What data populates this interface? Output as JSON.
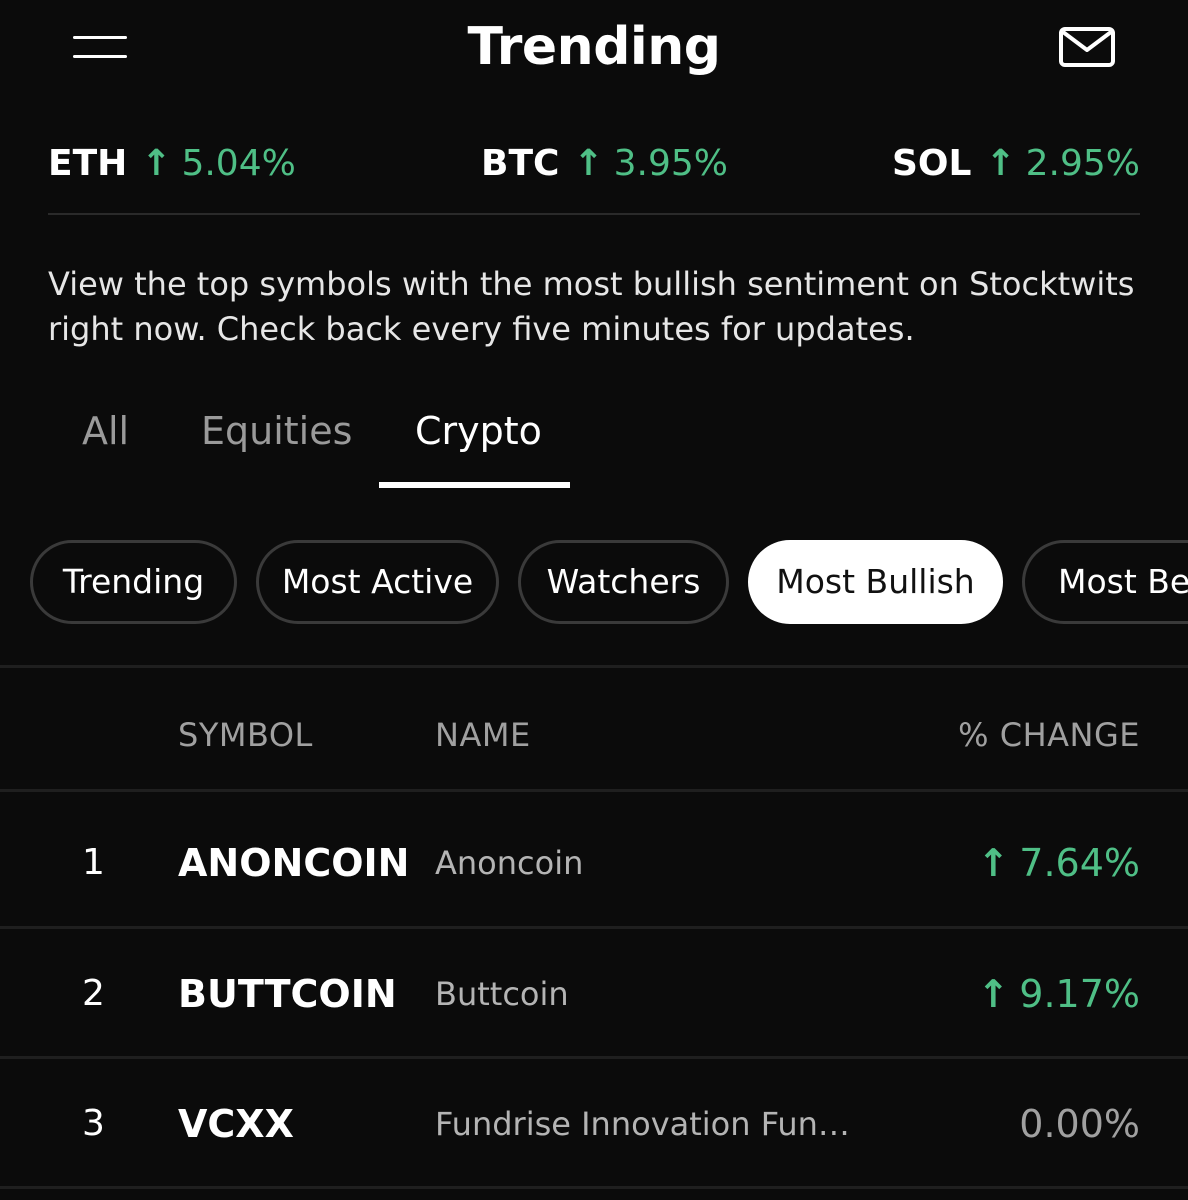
{
  "header": {
    "title": "Trending"
  },
  "ticker": [
    {
      "symbol": "ETH",
      "arrow": "↑",
      "change": "5.04%"
    },
    {
      "symbol": "BTC",
      "arrow": "↑",
      "change": "3.95%"
    },
    {
      "symbol": "SOL",
      "arrow": "↑",
      "change": "2.95%"
    }
  ],
  "description": "View the top symbols with the most bullish sentiment on Stocktwits right now. Check back every five minutes for updates.",
  "tabs": [
    {
      "label": "All",
      "active": false
    },
    {
      "label": "Equities",
      "active": false
    },
    {
      "label": "Crypto",
      "active": true
    }
  ],
  "filters": [
    {
      "label": "Trending",
      "active": false
    },
    {
      "label": "Most Active",
      "active": false
    },
    {
      "label": "Watchers",
      "active": false
    },
    {
      "label": "Most Bullish",
      "active": true
    },
    {
      "label": "Most Bea",
      "active": false
    }
  ],
  "table": {
    "columns": {
      "symbol": "SYMBOL",
      "name": "NAME",
      "change": "% CHANGE"
    },
    "rows": [
      {
        "rank": "1",
        "symbol": "ANONCOIN",
        "name": "Anoncoin",
        "arrow": "↑",
        "change": "7.64%",
        "direction": "up"
      },
      {
        "rank": "2",
        "symbol": "BUTTCOIN",
        "name": "Buttcoin",
        "arrow": "↑",
        "change": "9.17%",
        "direction": "up"
      },
      {
        "rank": "3",
        "symbol": "VCXX",
        "name": "Fundrise Innovation Fun…",
        "arrow": "",
        "change": "0.00%",
        "direction": "flat"
      }
    ]
  },
  "colors": {
    "background": "#0b0b0b",
    "positive": "#4fbf86",
    "neutral": "#a0a0a0",
    "active_chip_bg": "#ffffff"
  },
  "icons": {
    "menu": "hamburger-menu-icon",
    "mail": "mail-envelope-icon"
  }
}
